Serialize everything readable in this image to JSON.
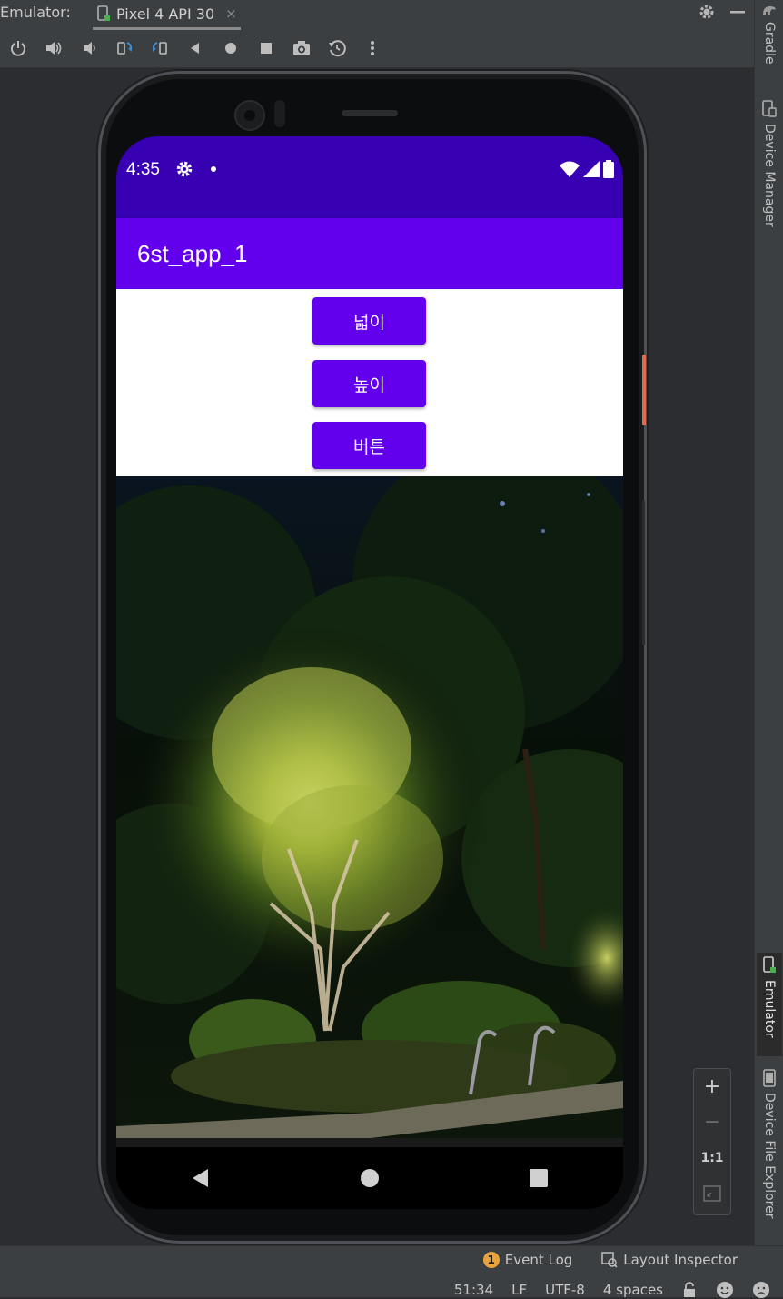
{
  "ide": {
    "title": "Emulator:",
    "tab_label": "Pixel 4 API 30",
    "tab_close": "×",
    "toolbar_icons": [
      "power-icon",
      "volume-up-icon",
      "volume-down-icon",
      "rotate-left-icon",
      "rotate-right-icon",
      "back-icon",
      "home-icon",
      "overview-icon",
      "camera-icon",
      "snapshot-icon",
      "more-icon"
    ],
    "right_tabs": {
      "gradle": "Gradle",
      "device_manager": "Device Manager",
      "emulator": "Emulator",
      "device_file_explorer": "Device File Explorer"
    },
    "zoom": {
      "plus": "+",
      "minus": "−",
      "one_to_one": "1:1"
    },
    "bottom": {
      "event_log_count": "1",
      "event_log": "Event Log",
      "layout_inspector": "Layout Inspector",
      "position": "51:34",
      "line_sep": "LF",
      "encoding": "UTF-8",
      "indent": "4 spaces"
    }
  },
  "device": {
    "status": {
      "time": "4:35"
    },
    "app_title": "6st_app_1",
    "buttons": [
      "넓이",
      "높이",
      "버튼"
    ],
    "colors": {
      "status_bar": "#3700b3",
      "app_bar": "#6200ee",
      "button": "#6200ee"
    }
  }
}
